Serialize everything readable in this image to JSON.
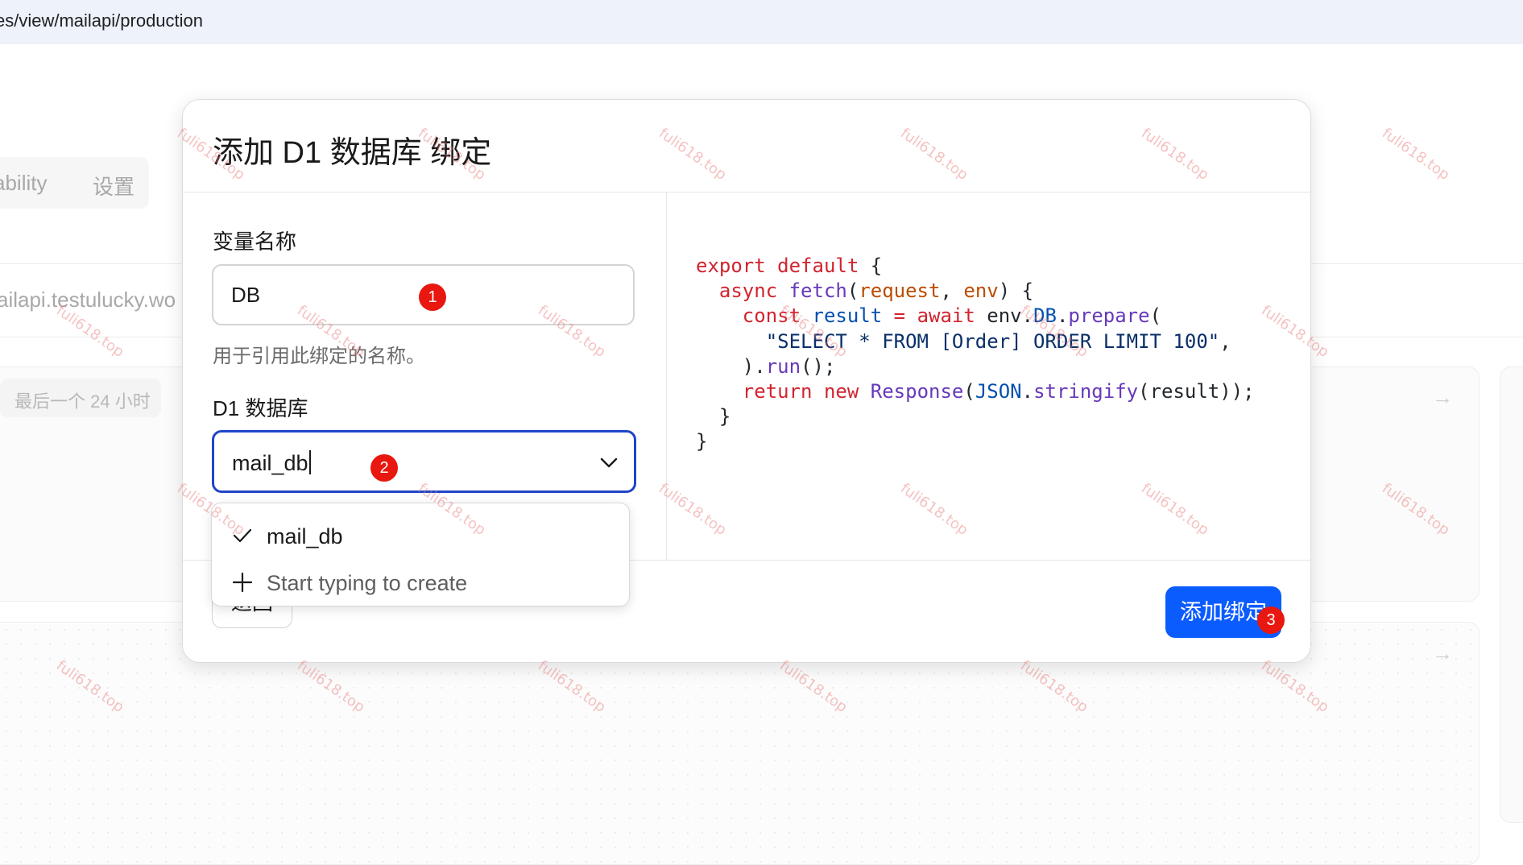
{
  "browser": {
    "url": "es/view/mailapi/production"
  },
  "background": {
    "tabs": [
      "ability",
      "设置"
    ],
    "domain": "ailapi.testulucky.wo",
    "range_label": "最后一个 24 小时"
  },
  "modal": {
    "title": "添加 D1 数据库 绑定",
    "variable": {
      "label": "变量名称",
      "value": "DB",
      "help": "用于引用此绑定的名称。"
    },
    "database": {
      "label": "D1 数据库",
      "value": "mail_db",
      "options": [
        {
          "label": "mail_db",
          "icon": "check-icon",
          "selected": true
        },
        {
          "label": "Start typing to create",
          "icon": "plus-icon",
          "selected": false
        }
      ]
    },
    "back_label": "返回",
    "add_label": "添加绑定"
  },
  "code": {
    "line1_kw1": "export",
    "line1_kw2": "default",
    "line1_br": "{",
    "line2_kw": "async",
    "line2_fn": "fetch",
    "line2_p1": "request",
    "line2_p2": "env",
    "line2_tail": ") {",
    "line3_kw": "const",
    "line3_var": "result",
    "line3_eq": "=",
    "line3_kw2": "await",
    "line3_env": "env.",
    "line3_db": "DB",
    "line3_fn": "prepare",
    "line4_str": "\"SELECT * FROM [Order] ORDER LIMIT 100\"",
    "line5_fn": "run",
    "line6_kw1": "return",
    "line6_kw2": "new",
    "line6_cls": "Response",
    "line6_json": "JSON",
    "line6_fn": "stringify",
    "line6_arg": "result"
  },
  "annotations": [
    "1",
    "2",
    "3"
  ],
  "watermark": "fuli618.top",
  "colors": {
    "accent": "#0b5cff",
    "focus_border": "#1f45c7",
    "badge": "#e8170f"
  }
}
